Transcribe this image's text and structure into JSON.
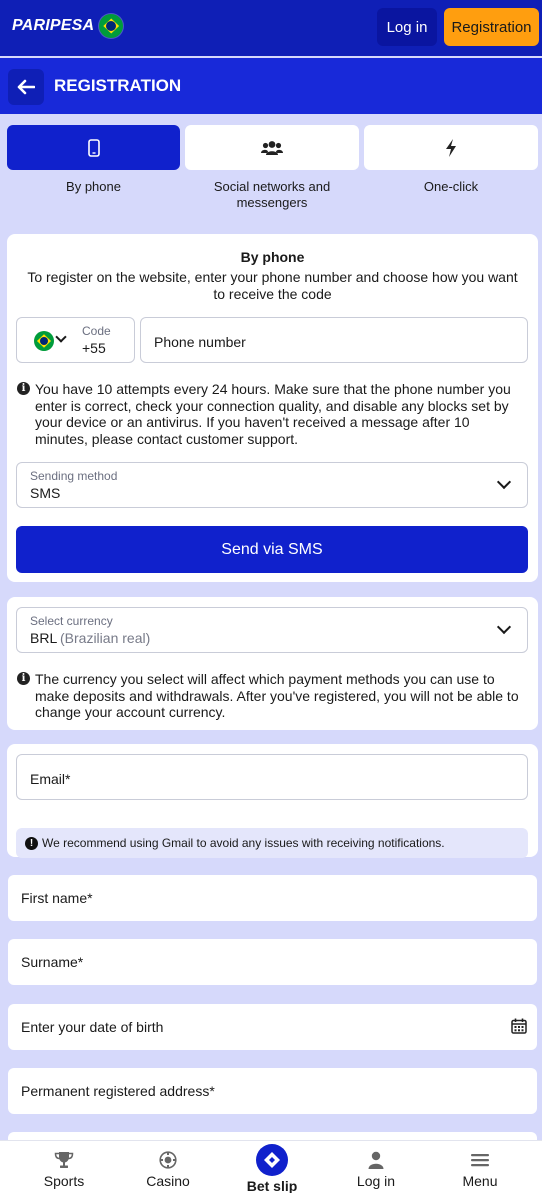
{
  "header": {
    "logo_text": "PARIPESA",
    "login_label": "Log in",
    "registration_label": "Registration"
  },
  "titlebar": {
    "title": "REGISTRATION"
  },
  "tabs": [
    {
      "label": "By phone",
      "icon": "smartphone-icon",
      "active": true
    },
    {
      "label": "Social networks and messengers",
      "icon": "users-icon",
      "active": false
    },
    {
      "label": "One-click",
      "icon": "lightning-icon",
      "active": false
    }
  ],
  "phone_card": {
    "heading": "By phone",
    "description": "To register on the website, enter your phone number and choose how you want to receive the code",
    "code_label": "Code",
    "code_value": "+55",
    "phone_placeholder": "Phone number",
    "attempts_note": "You have 10 attempts every 24 hours. Make sure that the phone number you enter is correct, check your connection quality, and disable any blocks set by your device or an antivirus. If you haven't received a message after 10 minutes, please contact customer support.",
    "sending_method_label": "Sending method",
    "sending_method_value": "SMS",
    "send_button": "Send via SMS"
  },
  "currency_card": {
    "label": "Select currency",
    "value_code": "BRL",
    "value_name": "(Brazilian real)",
    "note": "The currency you select will affect which payment methods you can use to make deposits and withdrawals. After you've registered, you will not be able to change your account currency."
  },
  "email_card": {
    "placeholder": "Email*",
    "gmail_note": "We recommend using Gmail to avoid any issues with receiving notifications."
  },
  "fields": {
    "first_name": "First name*",
    "surname": "Surname*",
    "dob": "Enter your date of birth",
    "address": "Permanent registered address*"
  },
  "bottom_nav": [
    {
      "label": "Sports",
      "icon": "trophy-icon"
    },
    {
      "label": "Casino",
      "icon": "casino-chip-icon"
    },
    {
      "label": "Bet slip",
      "icon": "ticket-icon"
    },
    {
      "label": "Log in",
      "icon": "user-icon"
    },
    {
      "label": "Menu",
      "icon": "hamburger-menu-icon"
    }
  ],
  "colors": {
    "header_bg": "#0f1fb6",
    "title_bg": "#1829d9",
    "accent_blue": "#1021cc",
    "registration_orange": "#ff9e0f",
    "page_bg": "#d6d9fb"
  }
}
